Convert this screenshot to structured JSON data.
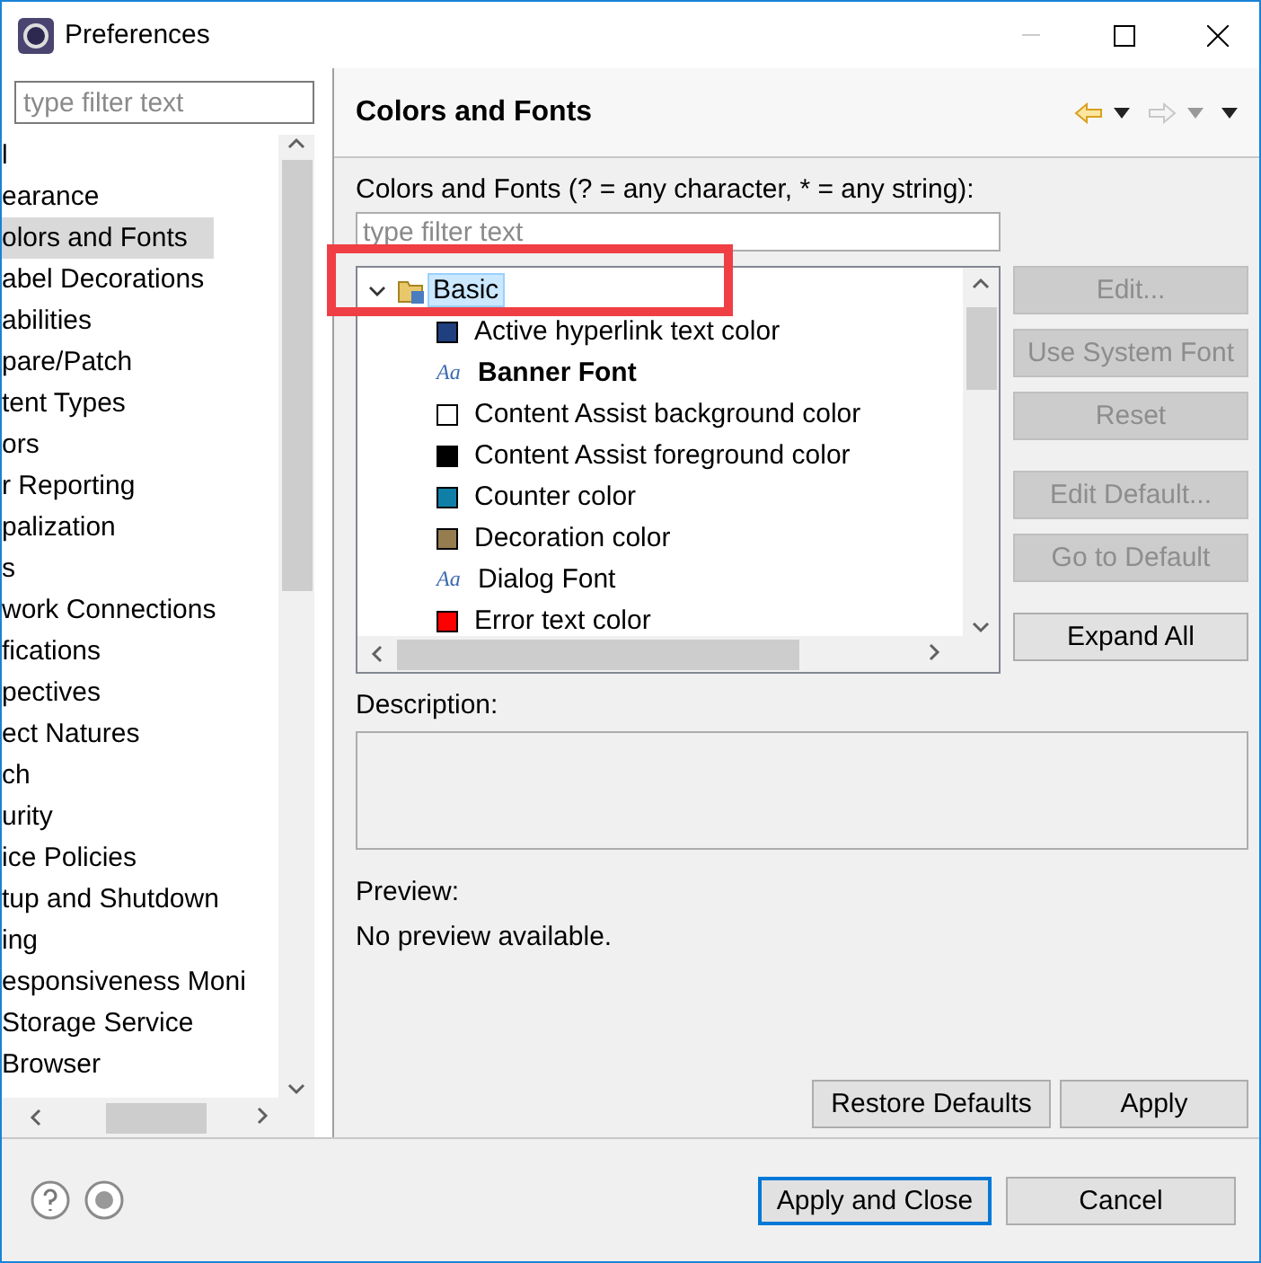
{
  "window": {
    "title": "Preferences"
  },
  "sidebar": {
    "filter_placeholder": "type filter text",
    "items": [
      {
        "label": "l",
        "selected": false
      },
      {
        "label": "earance",
        "selected": false
      },
      {
        "label": "olors and Fonts",
        "selected": true
      },
      {
        "label": "abel Decorations",
        "selected": false
      },
      {
        "label": "abilities",
        "selected": false
      },
      {
        "label": "pare/Patch",
        "selected": false
      },
      {
        "label": "tent Types",
        "selected": false
      },
      {
        "label": "ors",
        "selected": false
      },
      {
        "label": "r Reporting",
        "selected": false
      },
      {
        "label": "palization",
        "selected": false
      },
      {
        "label": "s",
        "selected": false
      },
      {
        "label": "work Connections",
        "selected": false
      },
      {
        "label": "fications",
        "selected": false
      },
      {
        "label": "pectives",
        "selected": false
      },
      {
        "label": "ect Natures",
        "selected": false
      },
      {
        "label": "ch",
        "selected": false
      },
      {
        "label": "urity",
        "selected": false
      },
      {
        "label": "ice Policies",
        "selected": false
      },
      {
        "label": "tup and Shutdown",
        "selected": false
      },
      {
        "label": "ing",
        "selected": false
      },
      {
        "label": "esponsiveness Moni",
        "selected": false
      },
      {
        "label": "Storage Service",
        "selected": false
      },
      {
        "label": "Browser",
        "selected": false
      }
    ]
  },
  "page": {
    "title": "Colors and Fonts",
    "filter_label": "Colors and Fonts (? = any character, * = any string):",
    "filter_placeholder": "type filter text",
    "tree": [
      {
        "label": "Basic",
        "expanded": true,
        "selected": true,
        "highlighted": true,
        "children": [
          {
            "kind": "color",
            "label": "Active hyperlink text color",
            "color": "#1f3f7f",
            "bold": false
          },
          {
            "kind": "font",
            "label": "Banner Font",
            "glyph": "Aa",
            "bold": true
          },
          {
            "kind": "color",
            "label": "Content Assist background color",
            "color": "#ffffff",
            "bold": false
          },
          {
            "kind": "color",
            "label": "Content Assist foreground color",
            "color": "#000000",
            "bold": false
          },
          {
            "kind": "color",
            "label": "Counter color",
            "color": "#0f7fa8",
            "bold": false
          },
          {
            "kind": "color",
            "label": "Decoration color",
            "color": "#957d4f",
            "bold": false
          },
          {
            "kind": "font",
            "label": "Dialog Font",
            "glyph": "Aa",
            "bold": false
          },
          {
            "kind": "color",
            "label": "Error text color",
            "color": "#ff0000",
            "bold": false
          }
        ]
      }
    ],
    "side_buttons": [
      {
        "label": "Edit...",
        "disabled": true
      },
      {
        "label": "Use System Font",
        "disabled": true
      },
      {
        "label": "Reset",
        "disabled": true
      },
      {
        "label": "Edit Default...",
        "disabled": true
      },
      {
        "label": "Go to Default",
        "disabled": true
      },
      {
        "label": "Expand All",
        "disabled": false
      }
    ],
    "description_label": "Description:",
    "preview_label": "Preview:",
    "preview_text": "No preview available.",
    "buttons": [
      {
        "label": "Restore Defaults"
      },
      {
        "label": "Apply"
      }
    ]
  },
  "footer": {
    "buttons": [
      {
        "label": "Apply and Close",
        "default": true
      },
      {
        "label": "Cancel",
        "default": false
      }
    ]
  }
}
